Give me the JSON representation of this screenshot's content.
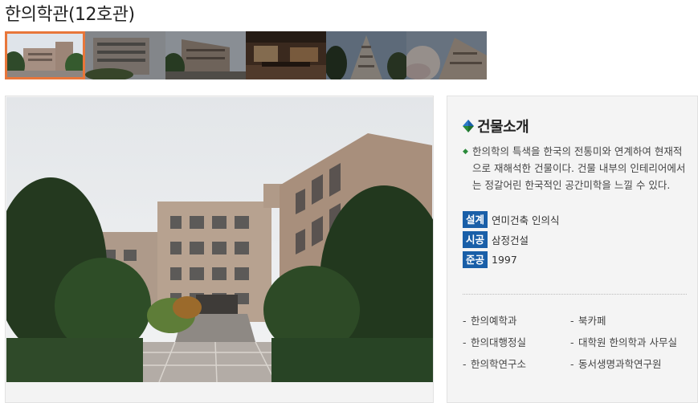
{
  "page": {
    "title": "한의학관(12호관)"
  },
  "gallery": {
    "thumbnails": [
      {
        "name": "thumb-1",
        "active": true
      },
      {
        "name": "thumb-2",
        "active": false
      },
      {
        "name": "thumb-3",
        "active": false
      },
      {
        "name": "thumb-4",
        "active": false
      },
      {
        "name": "thumb-5",
        "active": false
      },
      {
        "name": "thumb-6",
        "active": false
      }
    ]
  },
  "info": {
    "heading": "건물소개",
    "description": "한의학의 특색을 한국의 전통미와 연계하여 현재적으로 재해석한 건물이다. 건물 내부의 인테리어에서는 정갈어린 한국적인 공간미학을 느낄 수 있다.",
    "facts": [
      {
        "label": "설계",
        "value": "연미건축 인의식"
      },
      {
        "label": "시공",
        "value": "삼정건설"
      },
      {
        "label": "준공",
        "value": "1997"
      }
    ],
    "facilities": [
      "한의예학과",
      "북카페",
      "한의대행정실",
      "대학원 한의학과 사무실",
      "한의학연구소",
      "동서생명과학연구원"
    ]
  },
  "colors": {
    "accent_border": "#e8763a",
    "badge_blue": "#1a5fa8",
    "bullet_green": "#2a8a3a"
  }
}
